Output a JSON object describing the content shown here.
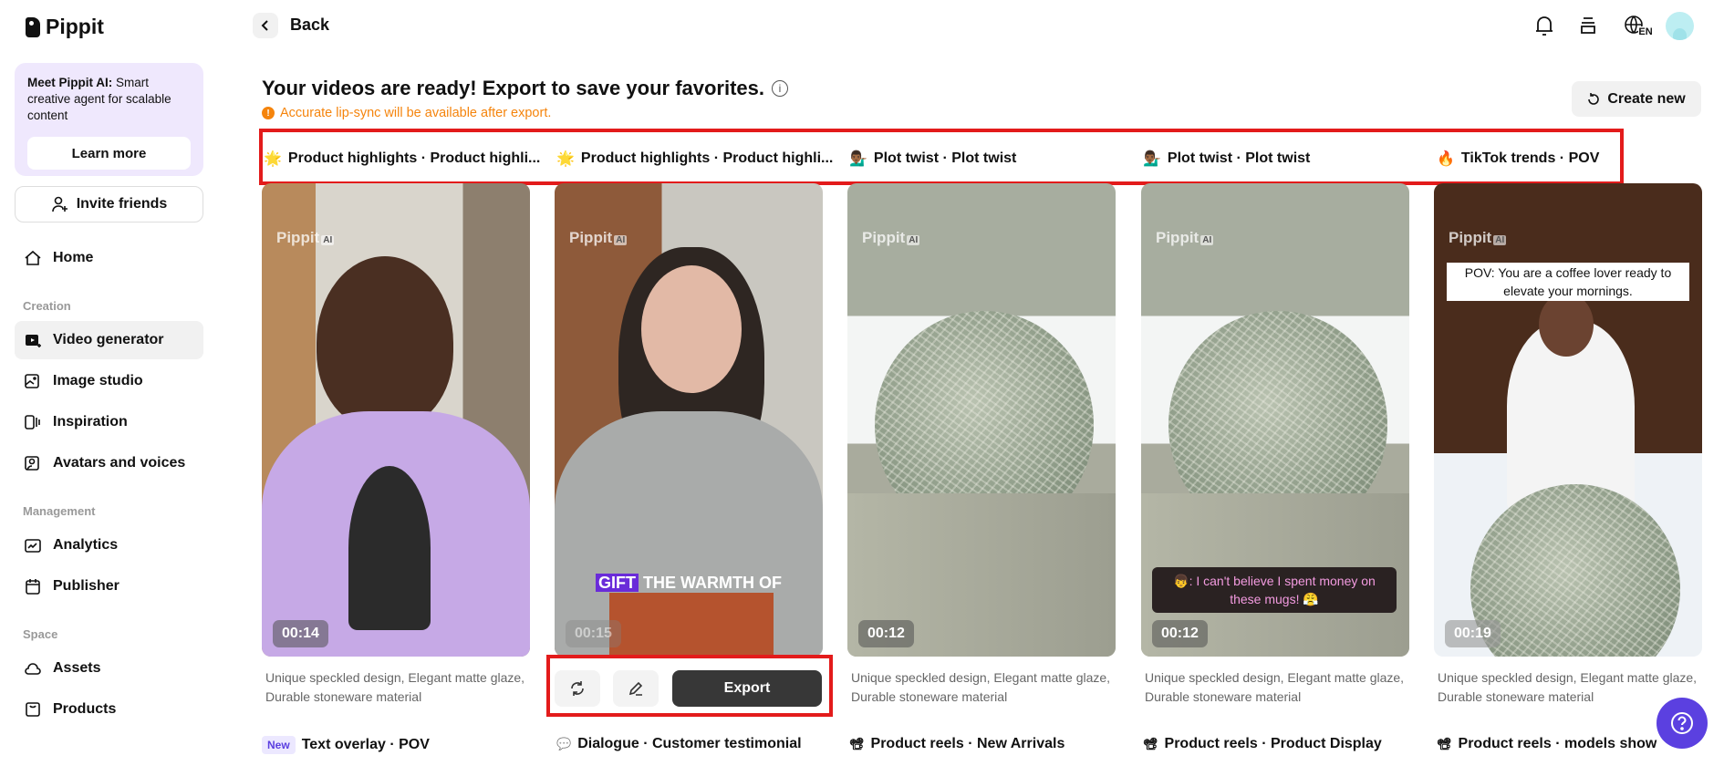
{
  "app": {
    "name": "Pippit"
  },
  "sidebar": {
    "promo": {
      "title": "Meet Pippit AI:",
      "text": " Smart creative agent for scalable content",
      "button": "Learn more"
    },
    "invite": "Invite friends",
    "home": "Home",
    "sections": [
      {
        "label": "Creation",
        "items": [
          "Video generator",
          "Image studio",
          "Inspiration",
          "Avatars and voices"
        ]
      },
      {
        "label": "Management",
        "items": [
          "Analytics",
          "Publisher"
        ]
      },
      {
        "label": "Space",
        "items": [
          "Assets",
          "Products"
        ]
      }
    ]
  },
  "header": {
    "back": "Back",
    "language": "EN"
  },
  "main": {
    "title": "Your videos are ready! Export to save your favorites.",
    "warning": "Accurate lip-sync will be available after export.",
    "create_new": "Create new",
    "tags": [
      {
        "emoji": "🌟",
        "text": "Product highlights · Product highli..."
      },
      {
        "emoji": "🌟",
        "text": "Product highlights · Product highli..."
      },
      {
        "emoji": "💁🏾‍♂️",
        "text": "Plot twist · Plot twist"
      },
      {
        "emoji": "💁🏾‍♂️",
        "text": "Plot twist · Plot twist"
      },
      {
        "emoji": "🔥",
        "text": "TikTok trends · POV"
      }
    ],
    "watermark": {
      "brand": "Pippit",
      "badge": "AI"
    },
    "cards": [
      {
        "duration": "00:14",
        "description": "Unique speckled design, Elegant matte glaze, Durable stoneware material"
      },
      {
        "duration": "00:15",
        "caption_highlight": "GIFT",
        "caption": " THE WARMTH OF"
      },
      {
        "duration": "00:12",
        "description": "Unique speckled design, Elegant matte glaze, Durable stoneware material"
      },
      {
        "duration": "00:12",
        "caption": "👦: I can't believe I spent money on these mugs! 😤",
        "description": "Unique speckled design, Elegant matte glaze, Durable stoneware material"
      },
      {
        "duration": "00:19",
        "caption": "POV: You are a coffee lover ready to elevate your mornings.",
        "description": "Unique speckled design, Elegant matte glaze, Durable stoneware material"
      }
    ],
    "export": "Export",
    "next_row": [
      {
        "badge": "New",
        "icon": "",
        "text": "Text overlay · POV"
      },
      {
        "icon": "💬",
        "text": "Dialogue · Customer testimonial"
      },
      {
        "icon": "📽",
        "text": "Product reels · New Arrivals"
      },
      {
        "icon": "📽",
        "text": "Product reels · Product Display"
      },
      {
        "icon": "📽",
        "text": "Product reels · models show"
      }
    ]
  },
  "colors": {
    "accent": "#5b40e0",
    "warning": "#f5840c",
    "highlight_box": "#e31b1b",
    "promo_bg": "#efe8fd"
  }
}
